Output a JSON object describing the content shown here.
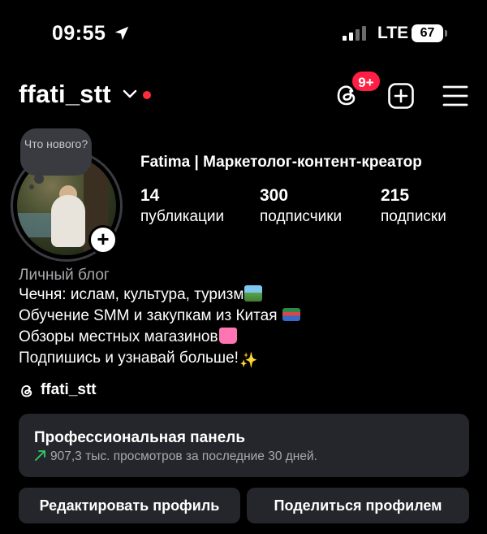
{
  "status_bar": {
    "time": "09:55",
    "network": "LTE",
    "battery": "67"
  },
  "header": {
    "username": "ffati_stt",
    "notification_badge": "9+"
  },
  "note": {
    "text": "Что нового?"
  },
  "profile": {
    "display_name": "Fatima | Маркетолог-контент-креатор",
    "stats": [
      {
        "value": "14",
        "label": "публикации"
      },
      {
        "value": "300",
        "label": "подписчики"
      },
      {
        "value": "215",
        "label": "подписки"
      }
    ],
    "category": "Личный блог",
    "bio": [
      "Чечня: ислам, культура, туризм",
      "Обучение SMM и закупкам из Китая",
      "Обзоры местных магазинов",
      "Подпишись и узнавай больше!"
    ],
    "threads_handle": "ffati_stt"
  },
  "dashboard": {
    "title": "Профессиональная панель",
    "subtitle": "907,3 тыс. просмотров за последние 30 дней."
  },
  "buttons": {
    "edit": "Редактировать профиль",
    "share": "Поделиться профилем"
  },
  "colors": {
    "background": "#000000",
    "badge": "#ff1f44",
    "panel": "#25262b",
    "trend": "#2fcf6a"
  },
  "icons": {
    "location": "location-arrow-icon",
    "threads": "threads-icon",
    "add": "add-square-icon",
    "menu": "hamburger-menu-icon"
  }
}
